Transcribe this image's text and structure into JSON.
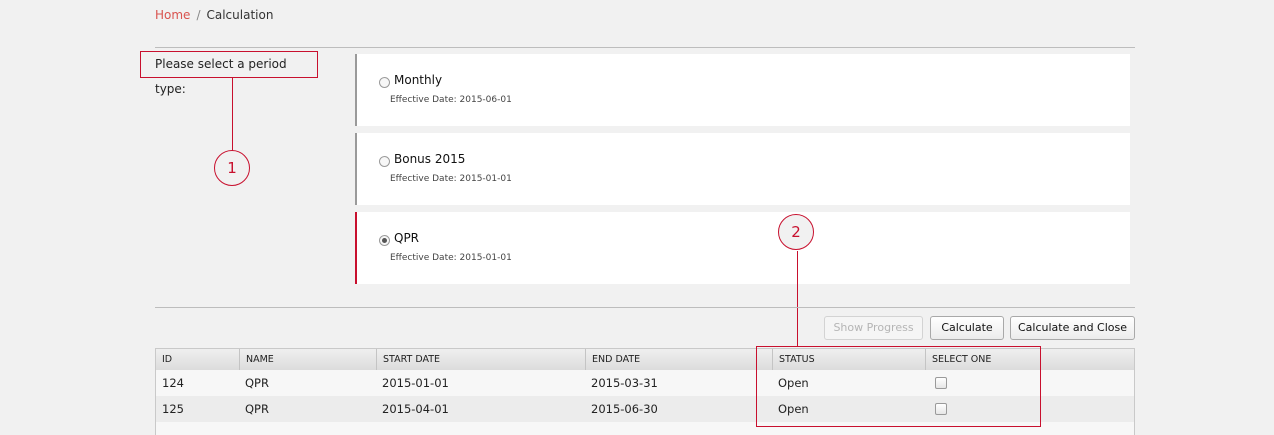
{
  "breadcrumb": {
    "home": "Home",
    "separator": "/",
    "current": "Calculation"
  },
  "prompt": {
    "label": "Please select a period type:"
  },
  "callouts": {
    "one": "1",
    "two": "2"
  },
  "periods": [
    {
      "name": "Monthly",
      "effective": "Effective Date: 2015-06-01",
      "selected": false
    },
    {
      "name": "Bonus 2015",
      "effective": "Effective Date: 2015-01-01",
      "selected": false
    },
    {
      "name": "QPR",
      "effective": "Effective Date: 2015-01-01",
      "selected": true
    }
  ],
  "toolbar": {
    "show_progress": "Show Progress",
    "calculate": "Calculate",
    "calculate_close": "Calculate and Close"
  },
  "table": {
    "columns": [
      "ID",
      "NAME",
      "START DATE",
      "END DATE",
      "STATUS",
      "SELECT ONE"
    ],
    "rows": [
      {
        "id": "124",
        "name": "QPR",
        "start": "2015-01-01",
        "end": "2015-03-31",
        "status": "Open",
        "checked": false
      },
      {
        "id": "125",
        "name": "QPR",
        "start": "2015-04-01",
        "end": "2015-06-30",
        "status": "Open",
        "checked": false
      }
    ]
  },
  "colors": {
    "accent": "#c8102e",
    "link": "#d9534f",
    "background": "#f1f1f1"
  }
}
